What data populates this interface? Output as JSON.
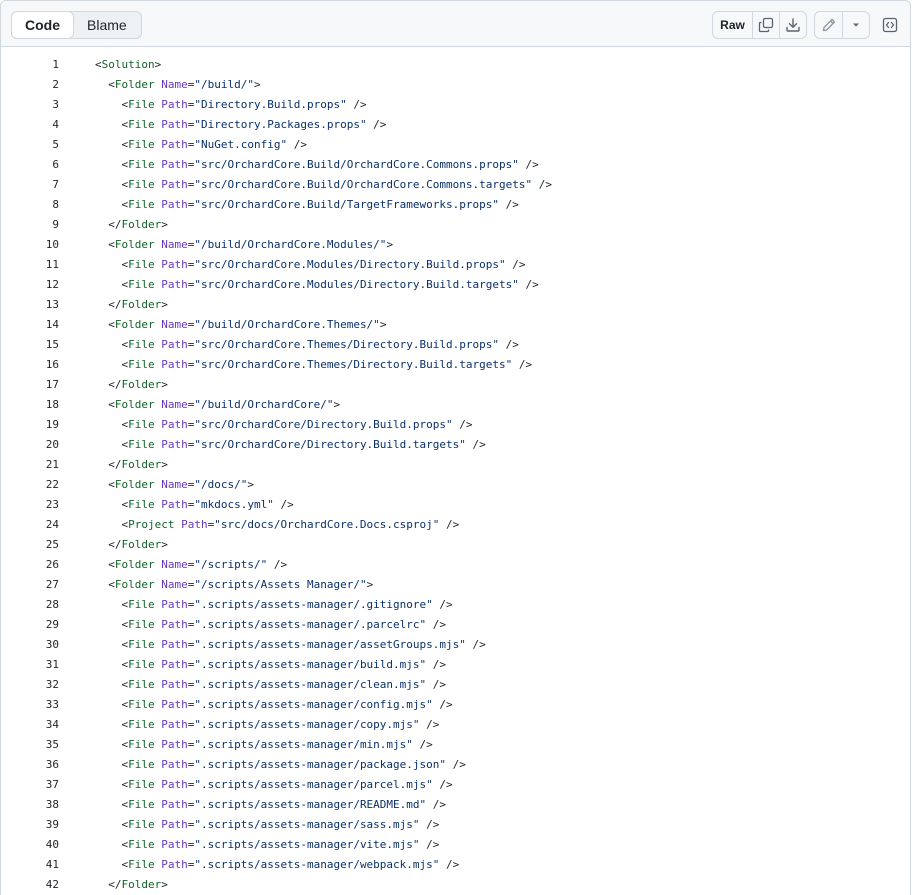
{
  "toolbar": {
    "code_tab": "Code",
    "blame_tab": "Blame",
    "raw_label": "Raw"
  },
  "lines": [
    {
      "n": "1",
      "text": "<Solution>"
    },
    {
      "n": "2",
      "text": "  <Folder Name=\"/build/\">"
    },
    {
      "n": "3",
      "text": "    <File Path=\"Directory.Build.props\" />"
    },
    {
      "n": "4",
      "text": "    <File Path=\"Directory.Packages.props\" />"
    },
    {
      "n": "5",
      "text": "    <File Path=\"NuGet.config\" />"
    },
    {
      "n": "6",
      "text": "    <File Path=\"src/OrchardCore.Build/OrchardCore.Commons.props\" />"
    },
    {
      "n": "7",
      "text": "    <File Path=\"src/OrchardCore.Build/OrchardCore.Commons.targets\" />"
    },
    {
      "n": "8",
      "text": "    <File Path=\"src/OrchardCore.Build/TargetFrameworks.props\" />"
    },
    {
      "n": "9",
      "text": "  </Folder>"
    },
    {
      "n": "10",
      "text": "  <Folder Name=\"/build/OrchardCore.Modules/\">"
    },
    {
      "n": "11",
      "text": "    <File Path=\"src/OrchardCore.Modules/Directory.Build.props\" />"
    },
    {
      "n": "12",
      "text": "    <File Path=\"src/OrchardCore.Modules/Directory.Build.targets\" />"
    },
    {
      "n": "13",
      "text": "  </Folder>"
    },
    {
      "n": "14",
      "text": "  <Folder Name=\"/build/OrchardCore.Themes/\">"
    },
    {
      "n": "15",
      "text": "    <File Path=\"src/OrchardCore.Themes/Directory.Build.props\" />"
    },
    {
      "n": "16",
      "text": "    <File Path=\"src/OrchardCore.Themes/Directory.Build.targets\" />"
    },
    {
      "n": "17",
      "text": "  </Folder>"
    },
    {
      "n": "18",
      "text": "  <Folder Name=\"/build/OrchardCore/\">"
    },
    {
      "n": "19",
      "text": "    <File Path=\"src/OrchardCore/Directory.Build.props\" />"
    },
    {
      "n": "20",
      "text": "    <File Path=\"src/OrchardCore/Directory.Build.targets\" />"
    },
    {
      "n": "21",
      "text": "  </Folder>"
    },
    {
      "n": "22",
      "text": "  <Folder Name=\"/docs/\">"
    },
    {
      "n": "23",
      "text": "    <File Path=\"mkdocs.yml\" />"
    },
    {
      "n": "24",
      "text": "    <Project Path=\"src/docs/OrchardCore.Docs.csproj\" />"
    },
    {
      "n": "25",
      "text": "  </Folder>"
    },
    {
      "n": "26",
      "text": "  <Folder Name=\"/scripts/\" />"
    },
    {
      "n": "27",
      "text": "  <Folder Name=\"/scripts/Assets Manager/\">"
    },
    {
      "n": "28",
      "text": "    <File Path=\".scripts/assets-manager/.gitignore\" />"
    },
    {
      "n": "29",
      "text": "    <File Path=\".scripts/assets-manager/.parcelrc\" />"
    },
    {
      "n": "30",
      "text": "    <File Path=\".scripts/assets-manager/assetGroups.mjs\" />"
    },
    {
      "n": "31",
      "text": "    <File Path=\".scripts/assets-manager/build.mjs\" />"
    },
    {
      "n": "32",
      "text": "    <File Path=\".scripts/assets-manager/clean.mjs\" />"
    },
    {
      "n": "33",
      "text": "    <File Path=\".scripts/assets-manager/config.mjs\" />"
    },
    {
      "n": "34",
      "text": "    <File Path=\".scripts/assets-manager/copy.mjs\" />"
    },
    {
      "n": "35",
      "text": "    <File Path=\".scripts/assets-manager/min.mjs\" />"
    },
    {
      "n": "36",
      "text": "    <File Path=\".scripts/assets-manager/package.json\" />"
    },
    {
      "n": "37",
      "text": "    <File Path=\".scripts/assets-manager/parcel.mjs\" />"
    },
    {
      "n": "38",
      "text": "    <File Path=\".scripts/assets-manager/README.md\" />"
    },
    {
      "n": "39",
      "text": "    <File Path=\".scripts/assets-manager/sass.mjs\" />"
    },
    {
      "n": "40",
      "text": "    <File Path=\".scripts/assets-manager/vite.mjs\" />"
    },
    {
      "n": "41",
      "text": "    <File Path=\".scripts/assets-manager/webpack.mjs\" />"
    },
    {
      "n": "42",
      "text": "  </Folder>"
    }
  ]
}
